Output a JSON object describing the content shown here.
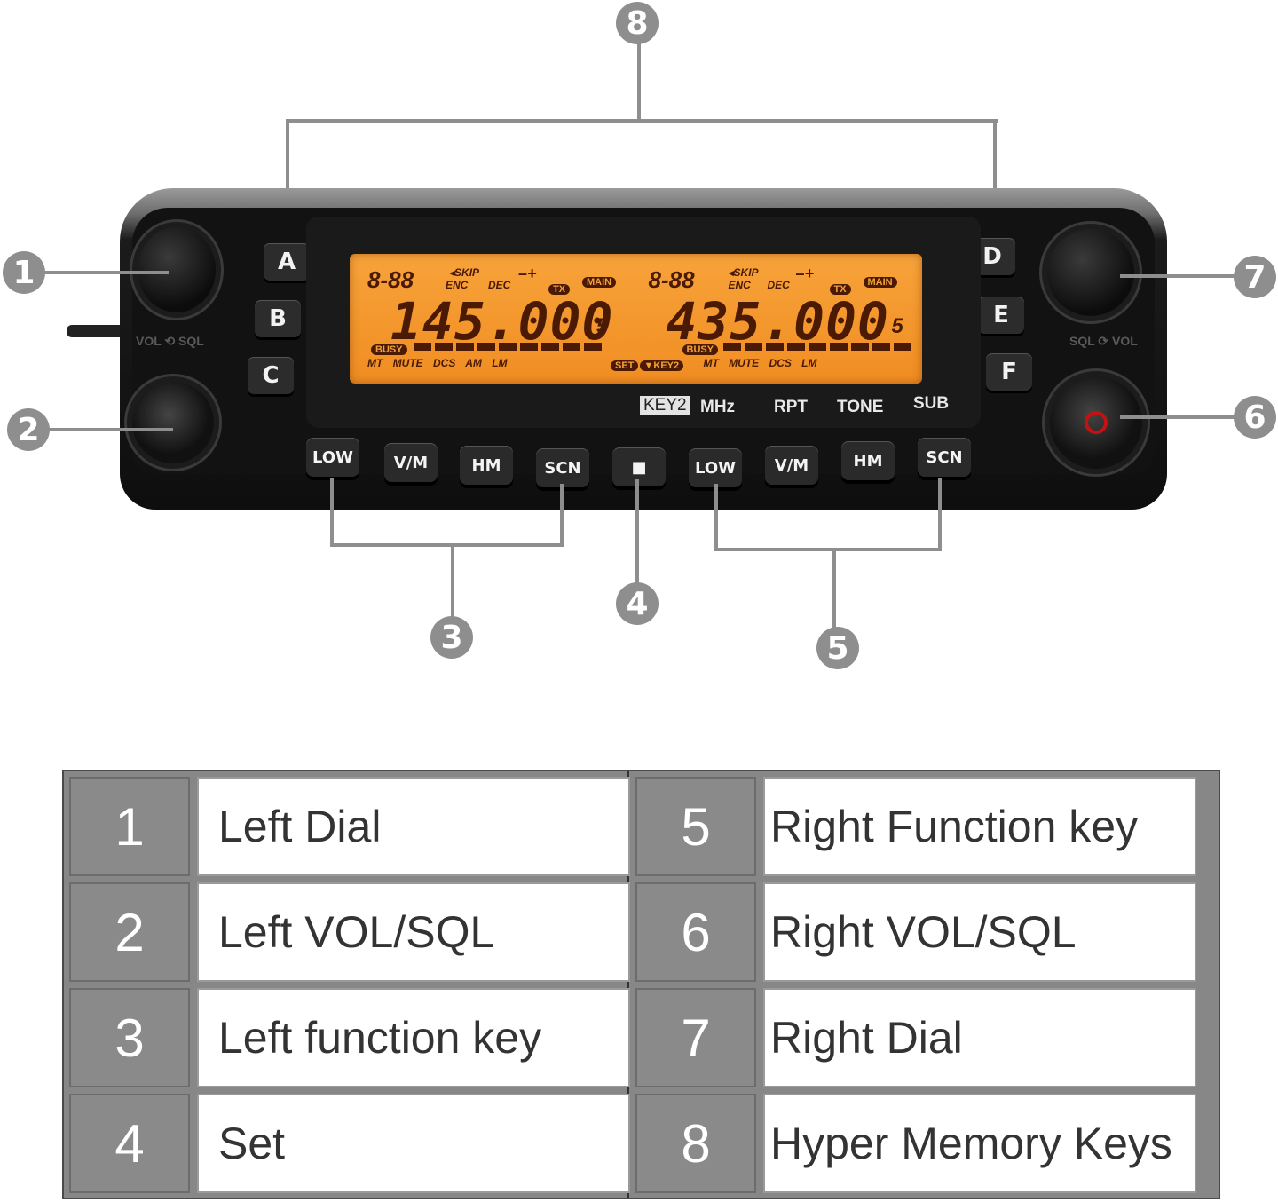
{
  "diagram": {
    "callouts": [
      {
        "number": "1",
        "target": "left-dial"
      },
      {
        "number": "2",
        "target": "left-vol-sql-knob"
      },
      {
        "number": "3",
        "target": "left-function-keys"
      },
      {
        "number": "4",
        "target": "set-key"
      },
      {
        "number": "5",
        "target": "right-function-keys"
      },
      {
        "number": "6",
        "target": "right-vol-sql-knob"
      },
      {
        "number": "7",
        "target": "right-dial"
      },
      {
        "number": "8",
        "target": "hyper-memory-keys"
      }
    ],
    "hyper_memory_keys": [
      "A",
      "B",
      "C",
      "D",
      "E",
      "F"
    ],
    "function_keys_left": [
      "LOW",
      "V/M",
      "HM",
      "SCN"
    ],
    "set_key": "■",
    "function_keys_right": [
      "LOW",
      "V/M",
      "HM",
      "SCN"
    ],
    "knob_labels": {
      "left": "VOL ⟲ SQL",
      "right": "SQL ⟳ VOL"
    },
    "panel_labels": {
      "key2": "KEY2",
      "mhz": "MHz",
      "rpt": "RPT",
      "tone": "TONE",
      "sub": "SUB"
    },
    "lcd": {
      "left": {
        "channel": "8-88",
        "skip": "◂SKIP",
        "enc": "ENC",
        "dec": "DEC",
        "offset": "–+",
        "tx": "TX",
        "main": "MAIN",
        "frequency": "145.000",
        "freq_suffix": "5",
        "busy": "BUSY",
        "bottom": "MT MUTE DCS AM LM",
        "set": "SET"
      },
      "right": {
        "channel": "8-88",
        "skip": "◂SKIP",
        "enc": "ENC",
        "dec": "DEC",
        "offset": "–+",
        "tx": "TX",
        "main": "MAIN",
        "frequency": "435.000",
        "freq_suffix": "5",
        "busy": "BUSY",
        "key2": "▼KEY2",
        "bottom": "MT MUTE DCS LM"
      }
    }
  },
  "legend": {
    "rows": [
      {
        "number": "1",
        "label": "Left Dial"
      },
      {
        "number": "2",
        "label": "Left VOL/SQL"
      },
      {
        "number": "3",
        "label": "Left function key"
      },
      {
        "number": "4",
        "label": "Set"
      },
      {
        "number": "5",
        "label": "Right Function key"
      },
      {
        "number": "6",
        "label": "Right VOL/SQL"
      },
      {
        "number": "7",
        "label": "Right Dial"
      },
      {
        "number": "8",
        "label": "Hyper Memory Keys"
      }
    ]
  },
  "colors": {
    "callout_gray": "#8e8e8e",
    "lcd_orange": "#f39a2e",
    "lcd_segment": "#4a1a04",
    "power_red": "#c31212"
  }
}
